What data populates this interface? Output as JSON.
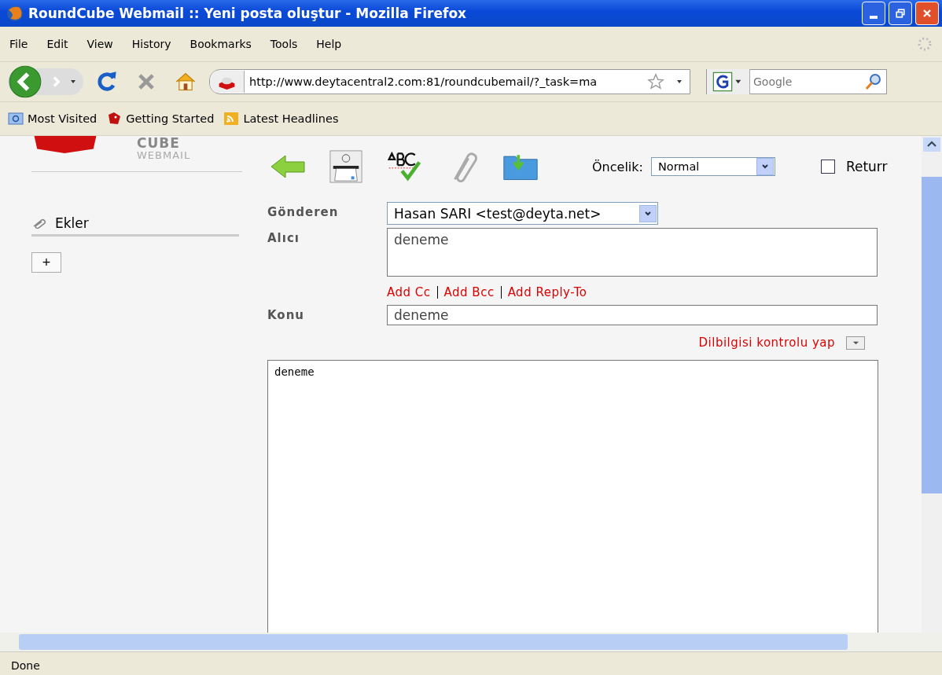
{
  "window": {
    "title": "RoundCube Webmail :: Yeni posta oluştur - Mozilla Firefox"
  },
  "menu": [
    "File",
    "Edit",
    "View",
    "History",
    "Bookmarks",
    "Tools",
    "Help"
  ],
  "address_bar": {
    "url": "http://www.deytacentral2.com:81/roundcubemail/?_task=ma"
  },
  "search": {
    "placeholder": "Google"
  },
  "bookmarks": [
    {
      "label": "Most Visited",
      "kind": "search"
    },
    {
      "label": "Getting Started",
      "kind": "bug"
    },
    {
      "label": "Latest Headlines",
      "kind": "feed"
    }
  ],
  "logo": {
    "line_1": "CUBE",
    "line_2": "WEBMAIL"
  },
  "sidebar": {
    "title": "Ekler",
    "add_button": "+"
  },
  "priority": {
    "label": "Öncelik:",
    "value": "Normal"
  },
  "return_receipt": {
    "label": "Returr",
    "checked": false
  },
  "form": {
    "from_label": "Gönderen",
    "from_value": "Hasan SARI <test@deyta.net>",
    "to_label": "Alıcı",
    "to_value": "deneme",
    "links": [
      "Add Cc",
      "Add Bcc",
      "Add Reply-To"
    ],
    "subject_label": "Konu",
    "subject_value": "deneme",
    "spellcheck": "Dilbilgisi kontrolu yap",
    "body": "deneme"
  },
  "status_bar": "Done"
}
